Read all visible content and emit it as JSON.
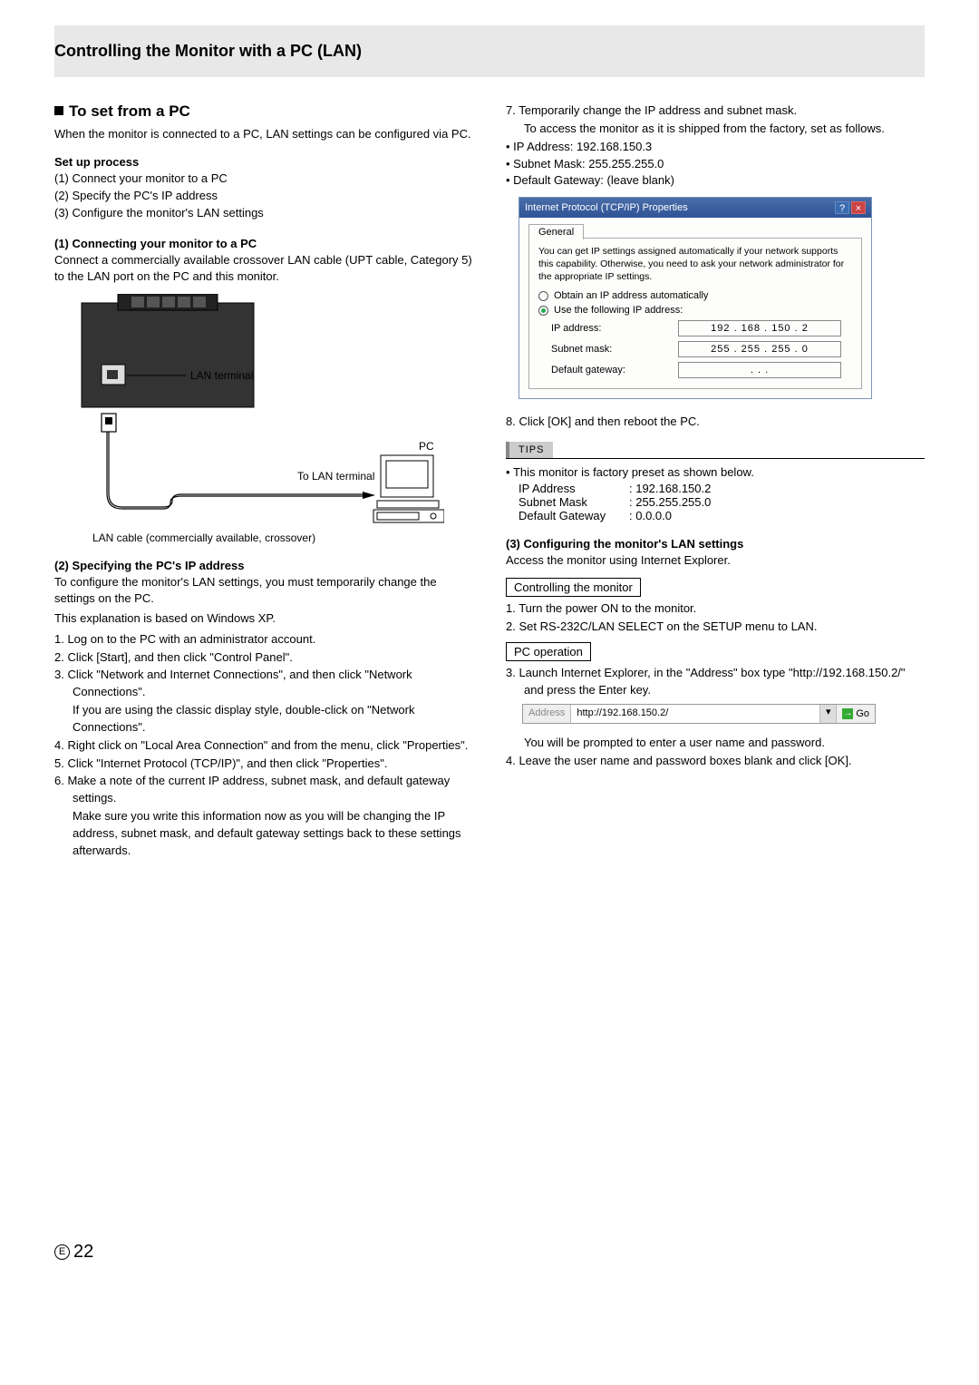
{
  "header": {
    "title": "Controlling the Monitor with a PC (LAN)"
  },
  "left": {
    "h2": "To set from a PC",
    "intro": "When the monitor is connected to a PC, LAN settings can be configured via PC.",
    "setup_h": "Set up process",
    "setup_items": [
      "(1) Connect your monitor to a PC",
      "(2) Specify the PC's IP address",
      "(3) Configure the monitor's LAN settings"
    ],
    "s1_h": "(1) Connecting your monitor to a PC",
    "s1_p": "Connect a commercially available crossover LAN cable (UPT cable, Category 5) to the LAN  port on the PC and this monitor.",
    "diagram": {
      "lan_terminal": "LAN terminal",
      "pc": "PC",
      "to_lan": "To LAN terminal",
      "caption": "LAN cable (commercially available, crossover)"
    },
    "s2_h": "(2) Specifying the PC's IP address",
    "s2_p1": "To configure the monitor's LAN settings, you must temporarily change the settings on the PC.",
    "s2_p2": "This explanation is based on Windows XP.",
    "s2_steps": [
      "1.  Log on to the PC with an administrator account.",
      "2.  Click [Start], and then click \"Control Panel\".",
      "3.  Click \"Network and Internet Connections\", and then click \"Network Connections\".",
      "    If you are using the classic display style, double-click on \"Network Connections\".",
      "4.  Right click on \"Local Area Connection\" and from the menu, click \"Properties\".",
      "5.  Click \"Internet Protocol (TCP/IP)\", and then click \"Properties\".",
      "6.  Make a note of the current IP address, subnet mask, and default gateway settings.",
      "    Make sure you write this information now as you will be changing the IP address, subnet mask, and default gateway settings back to these settings afterwards."
    ]
  },
  "right": {
    "step7_a": "7.  Temporarily change the IP address and subnet mask.",
    "step7_b": "To access the monitor as it is shipped from the factory, set as follows.",
    "step7_bullets": [
      "IP Address: 192.168.150.3",
      "Subnet Mask: 255.255.255.0",
      "Default Gateway: (leave blank)"
    ],
    "dialog": {
      "title": "Internet Protocol (TCP/IP) Properties",
      "tab": "General",
      "desc": "You can get IP settings assigned automatically if your network supports this capability. Otherwise, you need to ask your network administrator for the appropriate IP settings.",
      "opt1": "Obtain an IP address automatically",
      "opt2": "Use the following IP address:",
      "ip_l": "IP address:",
      "ip_v": "192 . 168 . 150 .   2",
      "sm_l": "Subnet mask:",
      "sm_v": "255 . 255 . 255 .   0",
      "dg_l": "Default gateway:",
      "dg_v": ".        .        ."
    },
    "step8": "8.  Click [OK] and then reboot the PC.",
    "tips_h": "TIPS",
    "tips_line": "This monitor is factory preset as shown below.",
    "tips_rows": [
      {
        "k": "IP Address",
        "v": ": 192.168.150.2"
      },
      {
        "k": "Subnet Mask",
        "v": ": 255.255.255.0"
      },
      {
        "k": "Default Gateway",
        "v": ": 0.0.0.0"
      }
    ],
    "s3_h": "(3) Configuring the monitor's LAN settings",
    "s3_p": "Access the monitor using Internet Explorer.",
    "box1": "Controlling the monitor",
    "s3_steps_a": [
      "1.  Turn the power ON to the monitor.",
      "2.  Set RS-232C/LAN SELECT on the SETUP menu to LAN."
    ],
    "box2": "PC operation",
    "s3_steps_b": [
      "3.  Launch Internet Explorer, in the \"Address\" box type \"http://192.168.150.2/\" and press the Enter key."
    ],
    "addr": {
      "label": "Address",
      "value": "http://192.168.150.2/",
      "go": "Go"
    },
    "s3_after": [
      "    You will be prompted to enter a user name and password.",
      "4.  Leave the user name and password boxes blank and click [OK]."
    ]
  },
  "footer": {
    "e": "E",
    "page": "22"
  }
}
